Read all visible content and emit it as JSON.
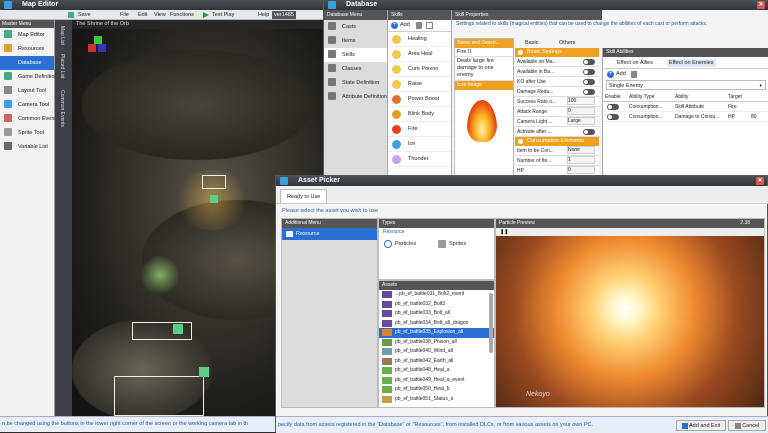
{
  "map_editor": {
    "title": "Map Editor",
    "toolbar": {
      "save": "Save",
      "file": "File",
      "edit": "Edit",
      "view": "View",
      "functions": "Functions",
      "test_play": "Test Play",
      "help": "Help",
      "extra": "ver1485"
    },
    "master_menu": {
      "title": "Master Menu",
      "items": [
        "Map Editor",
        "Resources",
        "Database",
        "Game Definition",
        "Layout Tool",
        "Camera Tool",
        "Common Events",
        "Sprite Tool",
        "Variable List"
      ],
      "selected_index": 2
    },
    "side_tabs": [
      "Map List",
      "Placed List",
      "Common Events"
    ],
    "viewport_title": "The Shrine of the Orb",
    "status_text": "n be changed using the buttons in the lower right corner of the screen or the working camera tab in th"
  },
  "database": {
    "title": "Database",
    "menu_header": "Database Menu",
    "menu_items": [
      "Casts",
      "Items",
      "Skills",
      "Classes",
      "State Definition",
      "Attribute Definition"
    ],
    "menu_selected_index": 2,
    "skills": {
      "header": "Skills",
      "add_label": "Add",
      "items": [
        "Healing",
        "Area Heal",
        "Cure Poison",
        "Raise",
        "Power Boost",
        "Blink Body",
        "Fire",
        "Ice",
        "Thunder"
      ]
    },
    "skill_props": {
      "header": "Skill Properties",
      "description": "Settings related to skills (magical entities) that can be used to change the abilities of each cast or perform attacks.",
      "name_header": "Name and Descri...",
      "name_value": "Fire II",
      "desc_value": "Deals large fire damage to one enemy",
      "icon_label": "Icon Image",
      "tabs": [
        "Basic",
        "Others"
      ],
      "basic_section": "Basic Settings",
      "rows": [
        {
          "label": "Available on Ma...",
          "value": ""
        },
        {
          "label": "Available in Ba...",
          "value": ""
        },
        {
          "label": "KO after Use",
          "value": ""
        },
        {
          "label": "Damage Redu...",
          "value": ""
        },
        {
          "label": "Success Rate o...",
          "value": "100"
        },
        {
          "label": "Attack Range",
          "value": "0"
        },
        {
          "label": "Camera Light ...",
          "value": "Large"
        },
        {
          "label": "Activate after ...",
          "value": ""
        }
      ],
      "consumption_section": "Consumption Elements",
      "consumption_rows": [
        {
          "label": "Item to be Con...",
          "value": "None"
        },
        {
          "label": "Number of Ite...",
          "value": "1"
        },
        {
          "label": "HP",
          "value": "0"
        }
      ]
    },
    "skill_abilities": {
      "header": "Skill Abilities",
      "tabs": [
        "Effect on Allies",
        "Effect on Enemies"
      ],
      "add_label": "Add",
      "target_select": "Single Enemy",
      "columns": [
        "Enable",
        "Ability Type",
        "Ability",
        "Target"
      ],
      "rows": [
        {
          "type": "Consumption...",
          "ability": "Skill Attribute",
          "target": "Fire"
        },
        {
          "type": "Consumption...",
          "ability": "Damage to Consu...",
          "target": "HP",
          "value": "80"
        }
      ]
    }
  },
  "asset_picker": {
    "title": "Asset Picker",
    "tab": "Ready to Use",
    "instruction": "Please select the asset you wish to use",
    "additional_menu": "Additional Menu",
    "resource": "Resource",
    "types_header": "Types",
    "types_group": "Resource",
    "types": [
      "Particles",
      "Sprites"
    ],
    "assets_header": "Assets",
    "assets": [
      "...pb_ef_battle031_Bolt2_event",
      "pb_ef_battle032_Bolt3",
      "pb_ef_battle033_Bolt_all",
      "pb_ef_battle034_Bolt_all_dragon",
      "pb_ef_battle035_Explosion_all",
      "pb_ef_battle038_Poison_all",
      "pb_ef_battle040_Wind_all",
      "pb_ef_battle042_Earth_all",
      "pb_ef_battle048_Heal_a",
      "pb_ef_battle049_Heal_a_event",
      "pb_ef_battle050_Heal_b",
      "pb_ef_battle051_Status_a"
    ],
    "selected_asset_index": 4,
    "preview_header": "Particle Preview",
    "preview_time": "2.38",
    "preview_logo": "Nekoyo",
    "status_text": "pecify data from assets registered in the \"Database\" or \"Resources\", from installed DLCs, or from various assets on your own PC.",
    "add_exit": "Add and Exit",
    "cancel": "Cancel"
  },
  "colors": {
    "accent": "#2a6fd1",
    "orange": "#f0a020",
    "dark": "#30343b"
  }
}
